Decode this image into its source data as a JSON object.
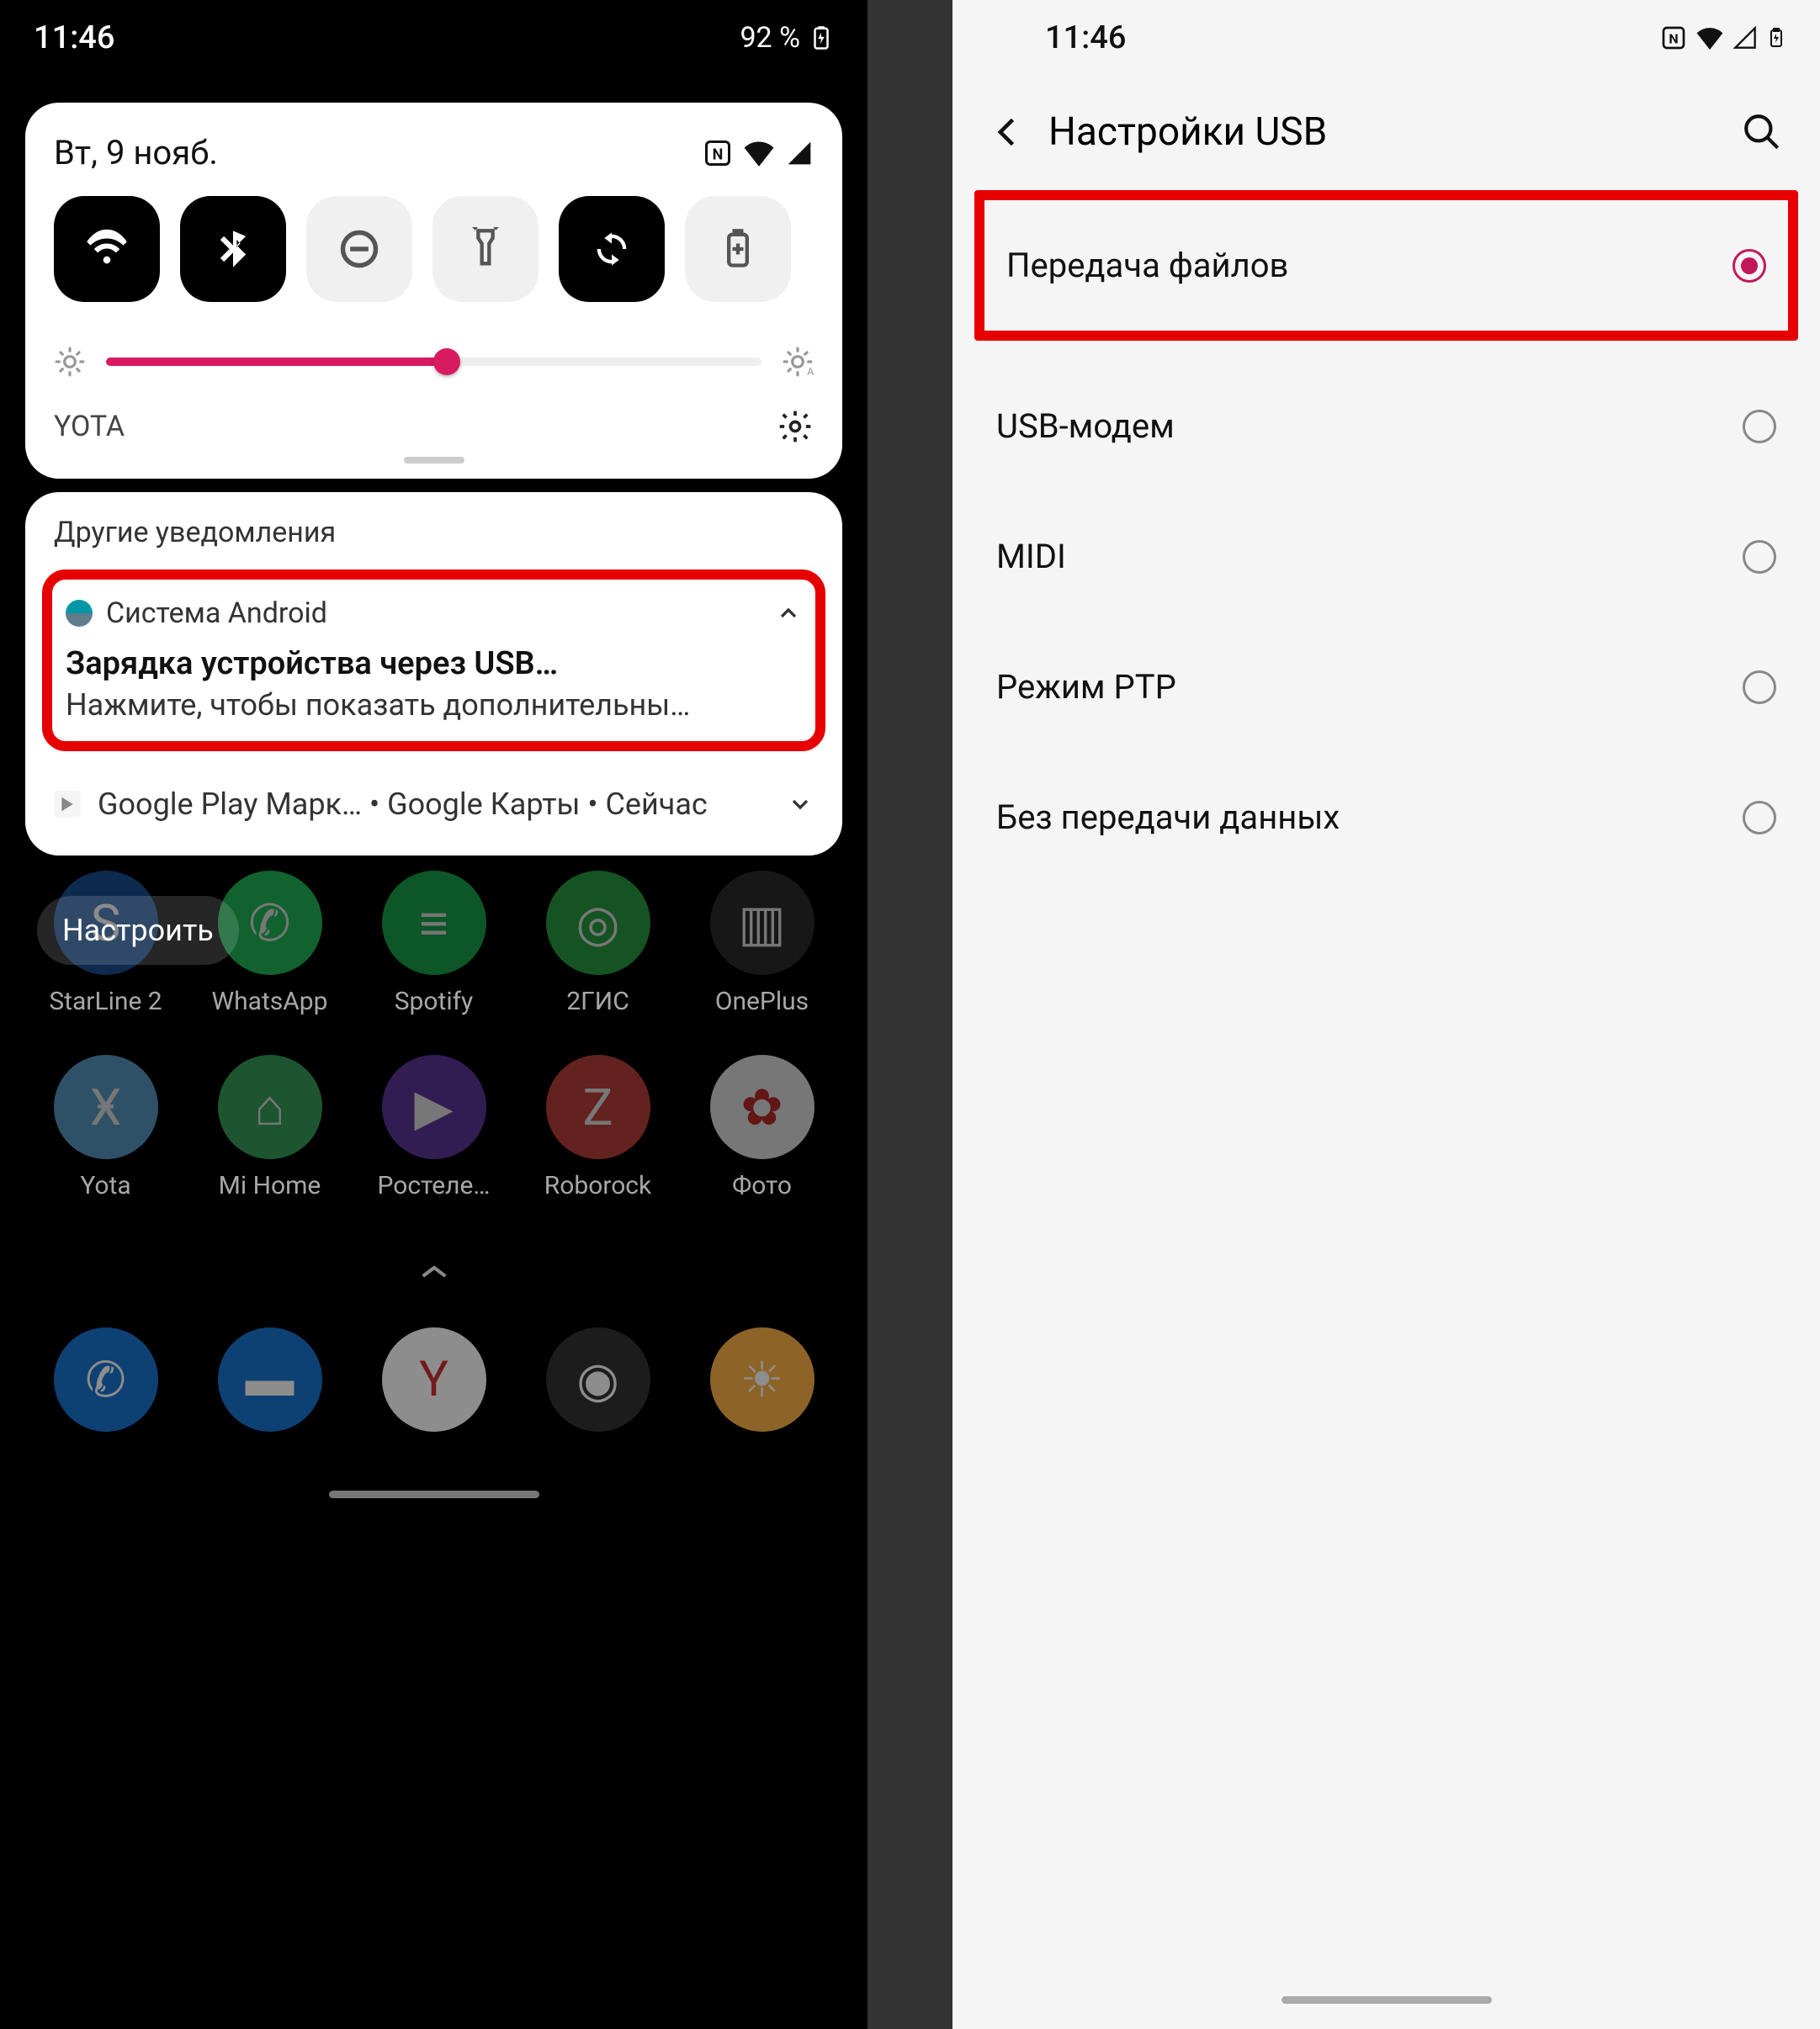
{
  "left": {
    "status": {
      "time": "11:46",
      "battery_text": "92 %"
    },
    "qs": {
      "date": "Вт, 9 нояб.",
      "tiles": [
        {
          "name": "wifi",
          "active": true
        },
        {
          "name": "bluetooth",
          "active": true
        },
        {
          "name": "dnd",
          "active": false
        },
        {
          "name": "flashlight",
          "active": false
        },
        {
          "name": "autorotate",
          "active": true
        },
        {
          "name": "battery-saver",
          "active": false
        }
      ],
      "brightness_pct": 52,
      "carrier": "YOTA"
    },
    "notifications": {
      "section_title": "Другие уведомления",
      "main": {
        "app_name": "Система Android",
        "title": "Зарядка устройства через USB…",
        "body": "Нажмите, чтобы показать дополнительны…"
      },
      "collapsed": "Google Play Марк… • Google Карты • Сейчас"
    },
    "home": {
      "setup_button": "Настроить",
      "row1": [
        {
          "label": "StarLine 2",
          "bg": "#1f5ca8",
          "letter": "S"
        },
        {
          "label": "WhatsApp",
          "bg": "#25D366",
          "letter": "✆"
        },
        {
          "label": "Spotify",
          "bg": "#1DB954",
          "letter": "≡"
        },
        {
          "label": "2ГИС",
          "bg": "#2EB34A",
          "letter": "◎"
        },
        {
          "label": "OnePlus",
          "bg": "#333333",
          "letter": "▥"
        }
      ],
      "row2": [
        {
          "label": "Yota",
          "bg": "#66aee0",
          "letter": "Ӿ"
        },
        {
          "label": "Mi Home",
          "bg": "#3fb66a",
          "letter": "⌂"
        },
        {
          "label": "Ростеле…",
          "bg": "#6a3fb0",
          "letter": "▶"
        },
        {
          "label": "Roborock",
          "bg": "#d44a44",
          "letter": "Z"
        },
        {
          "label": "Фото",
          "bg": "#ffffff",
          "letter": "✿"
        }
      ],
      "dock": [
        {
          "name": "phone",
          "bg": "#1976D2",
          "letter": "✆"
        },
        {
          "name": "messages",
          "bg": "#1976D2",
          "letter": "▬"
        },
        {
          "name": "yandex",
          "bg": "#ffffff",
          "letter": "Y"
        },
        {
          "name": "camera",
          "bg": "#333333",
          "letter": "◉"
        },
        {
          "name": "weather",
          "bg": "#ffb347",
          "letter": "☀"
        }
      ]
    }
  },
  "right": {
    "status": {
      "time": "11:46"
    },
    "header": {
      "title": "Настройки USB"
    },
    "options": [
      {
        "label": "Передача файлов",
        "checked": true,
        "highlight": true
      },
      {
        "label": "USB-модем",
        "checked": false
      },
      {
        "label": "MIDI",
        "checked": false
      },
      {
        "label": "Режим PTP",
        "checked": false
      },
      {
        "label": "Без передачи данных",
        "checked": false
      }
    ]
  }
}
